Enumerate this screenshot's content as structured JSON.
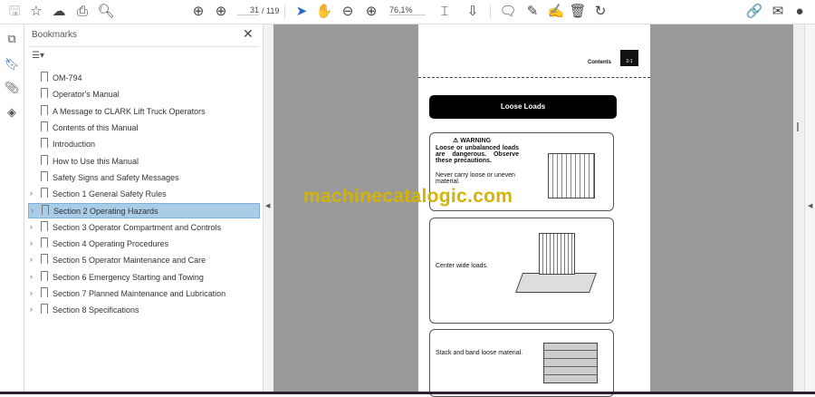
{
  "toolbar": {
    "page_current": "31",
    "page_total": "/ 119",
    "zoom": "76,1%"
  },
  "bookmarks": {
    "title": "Bookmarks",
    "items": [
      {
        "label": "OM-794",
        "expandable": false
      },
      {
        "label": "Operator's Manual",
        "expandable": false
      },
      {
        "label": "A Message to CLARK Lift Truck Operators",
        "expandable": false
      },
      {
        "label": "Contents of this Manual",
        "expandable": false
      },
      {
        "label": "Introduction",
        "expandable": false
      },
      {
        "label": "How to Use this Manual",
        "expandable": false
      },
      {
        "label": "Safety Signs and Safety Messages",
        "expandable": false
      },
      {
        "label": "Section 1 General Safety Rules",
        "expandable": true
      },
      {
        "label": "Section 2 Operating Hazards",
        "expandable": true,
        "selected": true
      },
      {
        "label": "Section 3 Operator Compartment and Controls",
        "expandable": true
      },
      {
        "label": "Section 4 Operating Procedures",
        "expandable": true
      },
      {
        "label": "Section 5 Operator Maintenance and Care",
        "expandable": true
      },
      {
        "label": "Section 6 Emergency Starting and Towing",
        "expandable": true
      },
      {
        "label": "Section 7 Planned Maintenance and Lubrication",
        "expandable": true
      },
      {
        "label": "Section 8 Specifications",
        "expandable": true
      }
    ]
  },
  "document": {
    "header": "Contents",
    "page_tab": "2-1",
    "banner": "Loose Loads",
    "warning_title": "WARNING",
    "warning_text": "Loose or unbalanced loads are dangerous. Observe these precautions.",
    "warning_sub": "Never carry loose or uneven material.",
    "box2": "Center wide loads.",
    "box3": "Stack and band loose material.",
    "watermark": "machinecatalogic.com"
  }
}
